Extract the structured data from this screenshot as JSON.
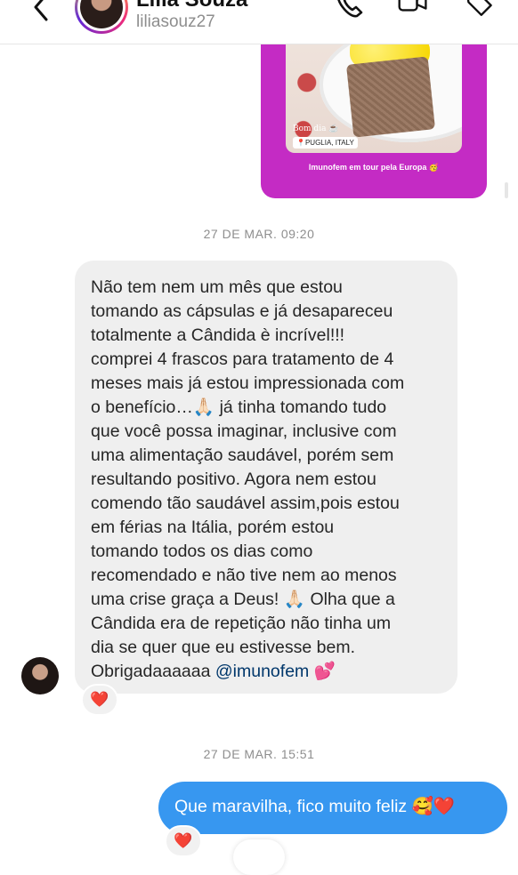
{
  "header": {
    "name": "Lilia Souza",
    "handle": "liliasouz27",
    "icons": [
      "back-chevron-icon",
      "phone-icon",
      "video-icon",
      "tag-icon"
    ]
  },
  "story": {
    "overlay_greeting": "Bom dia ☕",
    "location": "📍PUGLIA, ITALY",
    "caption": "Imunofem em tour pela Europa 🥳",
    "accent_color": "#c42bc4"
  },
  "timestamps": [
    "27 DE MAR. 09:20",
    "27 DE MAR. 15:51"
  ],
  "messages": {
    "incoming_lines": [
      "Não tem nem um mês que estou",
      "tomando as cápsulas e já desapareceu",
      "totalmente a Cândida è incrível!!!",
      "comprei 4 frascos para tratamento de 4",
      "meses mais já estou impressionada com",
      "o benefício…🙏🏻 já tinha tomando tudo",
      "que você possa imaginar, inclusive com",
      "uma alimentação saudável, porém sem",
      "resultando positivo. Agora nem estou",
      "comendo tão saudável assim,pois estou",
      "em férias na Itália, porém estou",
      "tomando todos os dias como",
      "recomendado e não tive nem ao menos",
      "uma crise graça a Deus! 🙏🏻 Olha que a",
      "Cândida era de repetição não tinha um",
      "dia se quer que eu estivesse bem."
    ],
    "incoming_last_line_prefix": "Obrigadaaaaaa ",
    "incoming_mention": "@imunofem",
    "incoming_last_emoji": " 💕",
    "incoming_reaction": "❤️",
    "outgoing": "Que maravilha, fico muito feliz 🥰❤️",
    "outgoing_reaction": "❤️",
    "outgoing_bubble_color": "#3797f0",
    "mention_color": "#00376b"
  }
}
